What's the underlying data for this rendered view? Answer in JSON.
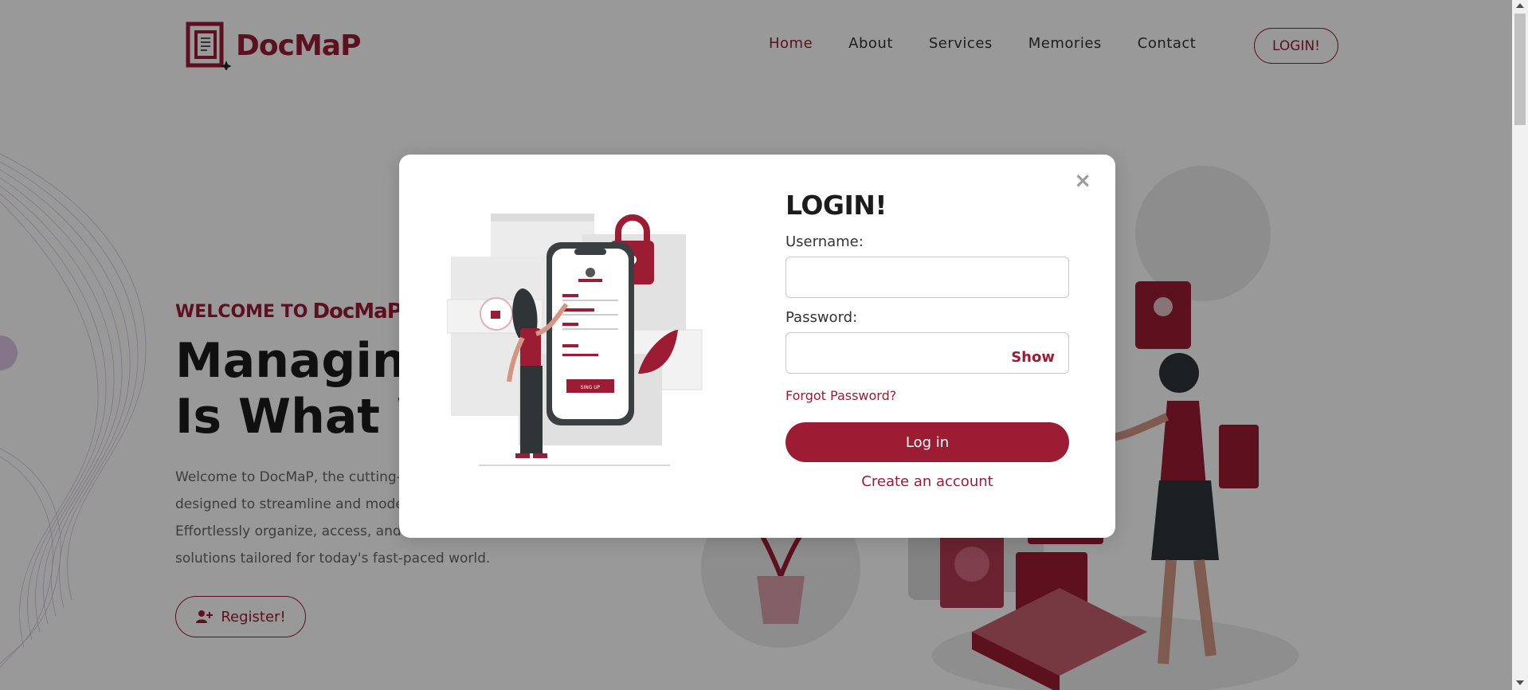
{
  "header": {
    "logo_text": "DocMaP",
    "nav": [
      "Home",
      "About",
      "Services",
      "Memories",
      "Contact"
    ],
    "active_nav": "Home",
    "login_button": "LOGIN!"
  },
  "hero": {
    "welcome_prefix": "WELCOME TO",
    "welcome_brand": "DocMaP!",
    "headline_line1": "Managing",
    "headline_line2": "Is What W",
    "description_lines": [
      "Welcome to DocMaP, the cutting-",
      "designed to streamline and mode",
      "Effortlessly organize, access, and c",
      "solutions tailored for today's fast-paced world."
    ],
    "register_button": "Register!"
  },
  "modal": {
    "close": "×",
    "title": "LOGIN!",
    "username_label": "Username:",
    "password_label": "Password:",
    "show_label": "Show",
    "forgot_link": "Forgot Password?",
    "login_button": "Log in",
    "create_link": "Create an account",
    "illustration_button_text": "SING UP"
  },
  "colors": {
    "brand": "#9b1c33",
    "overlay": "rgba(0,0,0,0.4)"
  }
}
